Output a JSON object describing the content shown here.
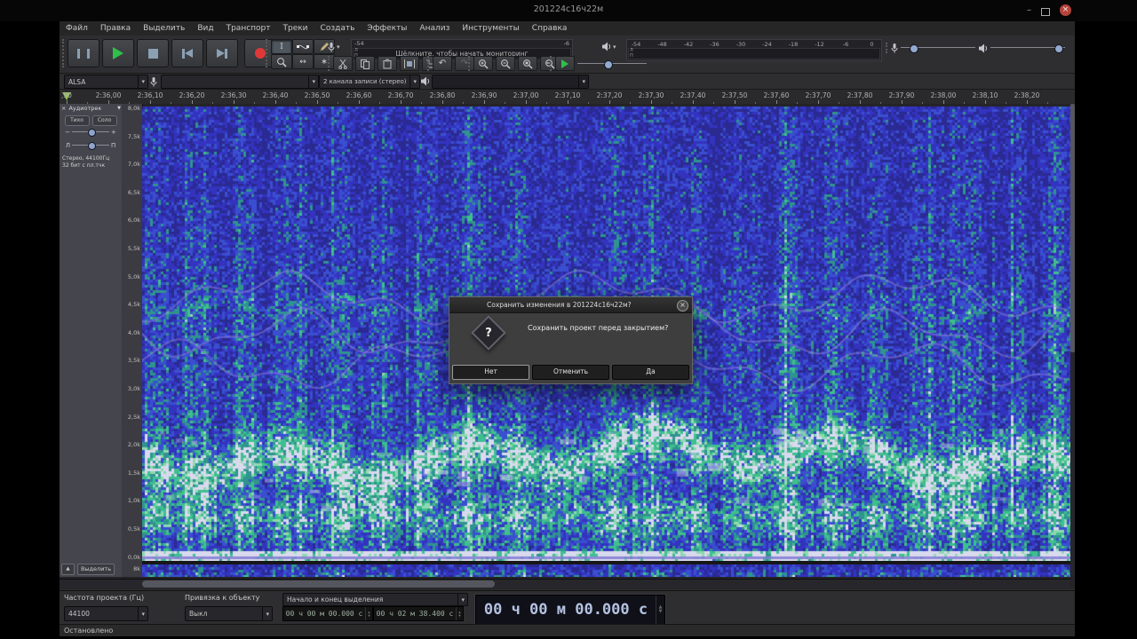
{
  "colors": {
    "play_green": "#2fc04a",
    "record_red": "#df3838",
    "spec_dark": "#2a2a92",
    "spec_blue": "#3333c0",
    "spec_teal": "#2f948e",
    "spec_bright": "#8fd9b0",
    "spec_white": "#d9d9ee",
    "spec_purple": "#8a82d8"
  },
  "titlebar": {
    "title": "201224с16ч22м"
  },
  "menu": {
    "items": [
      "Файл",
      "Правка",
      "Выделить",
      "Вид",
      "Транспорт",
      "Треки",
      "Создать",
      "Эффекты",
      "Анализ",
      "Инструменты",
      "Справка"
    ]
  },
  "icons": {
    "chevron": "▾",
    "minimize": "–",
    "close_x": "×",
    "undo": "↶",
    "redo": "↷",
    "timeshift": "↔",
    "multi_tool": "∗",
    "ibeam": "I",
    "spin_up": "▲",
    "spin_down": "▼",
    "collapse": "▲",
    "track_menu": "▼"
  },
  "meters": {
    "record_left": "-54",
    "record_right": "-6",
    "record_hint": "Щёлкните, чтобы начать мониторинг",
    "play_scale": [
      "-54",
      "-48",
      "-42",
      "-36",
      "-30",
      "-24",
      "-18",
      "-12",
      "-6",
      "0"
    ],
    "channel_left": "Л",
    "channel_right": "П"
  },
  "device": {
    "host": "ALSA",
    "input": "",
    "channels": "2 канала записи (стерео)",
    "output": ""
  },
  "timeline": {
    "ticks": [
      ",90",
      "2:36,00",
      "2:36,10",
      "2:36,20",
      "2:36,30",
      "2:36,40",
      "2:36,50",
      "2:36,60",
      "2:36,70",
      "2:36,80",
      "2:36,90",
      "2:37,00",
      "2:37,10",
      "2:37,20",
      "2:37,30",
      "2:37,40",
      "2:37,50",
      "2:37,60",
      "2:37,70",
      "2:37,80",
      "2:37,90",
      "2:38,00",
      "2:38,10",
      "2:38,20"
    ]
  },
  "track": {
    "close_label": "×",
    "name": "Аудиотрек",
    "mute": "Тихо",
    "solo": "Соло",
    "gain_minus": "−",
    "gain_plus": "+",
    "pan_left": "Л",
    "pan_right": "П",
    "info_line1": "Стерео, 44100Гц",
    "info_line2": "32 бит с пл.тчк",
    "select_button": "Выделить"
  },
  "freq_ruler": {
    "labels": [
      "8,0k",
      "7,5k",
      "7,0k",
      "6,5k",
      "6,0k",
      "5,5k",
      "5,0k",
      "4,5k",
      "4,0k",
      "3,5k",
      "3,0k",
      "2,5k",
      "2,0k",
      "1,5k",
      "1,0k",
      "0,5k",
      "0,0k"
    ],
    "second_track_top": "8k"
  },
  "dialog": {
    "title": "Сохранить изменения в 201224с16ч22м?",
    "icon": "?",
    "message": "Сохранить проект перед закрытием?",
    "no": "Нет",
    "cancel": "Отменить",
    "yes": "Да"
  },
  "selection_bar": {
    "rate_label": "Частота проекта (Гц)",
    "rate_value": "44100",
    "snap_label": "Привязка к объекту",
    "snap_value": "Выкл",
    "range_mode": "Начало и конец выделения",
    "sel_start": "00 ч 00 м 00.000 с",
    "sel_end": "00 ч 02 м 38.400 с"
  },
  "time_display": {
    "value": "00 ч 00 м 00.000 с"
  },
  "statusbar": {
    "text": "Остановлено"
  }
}
